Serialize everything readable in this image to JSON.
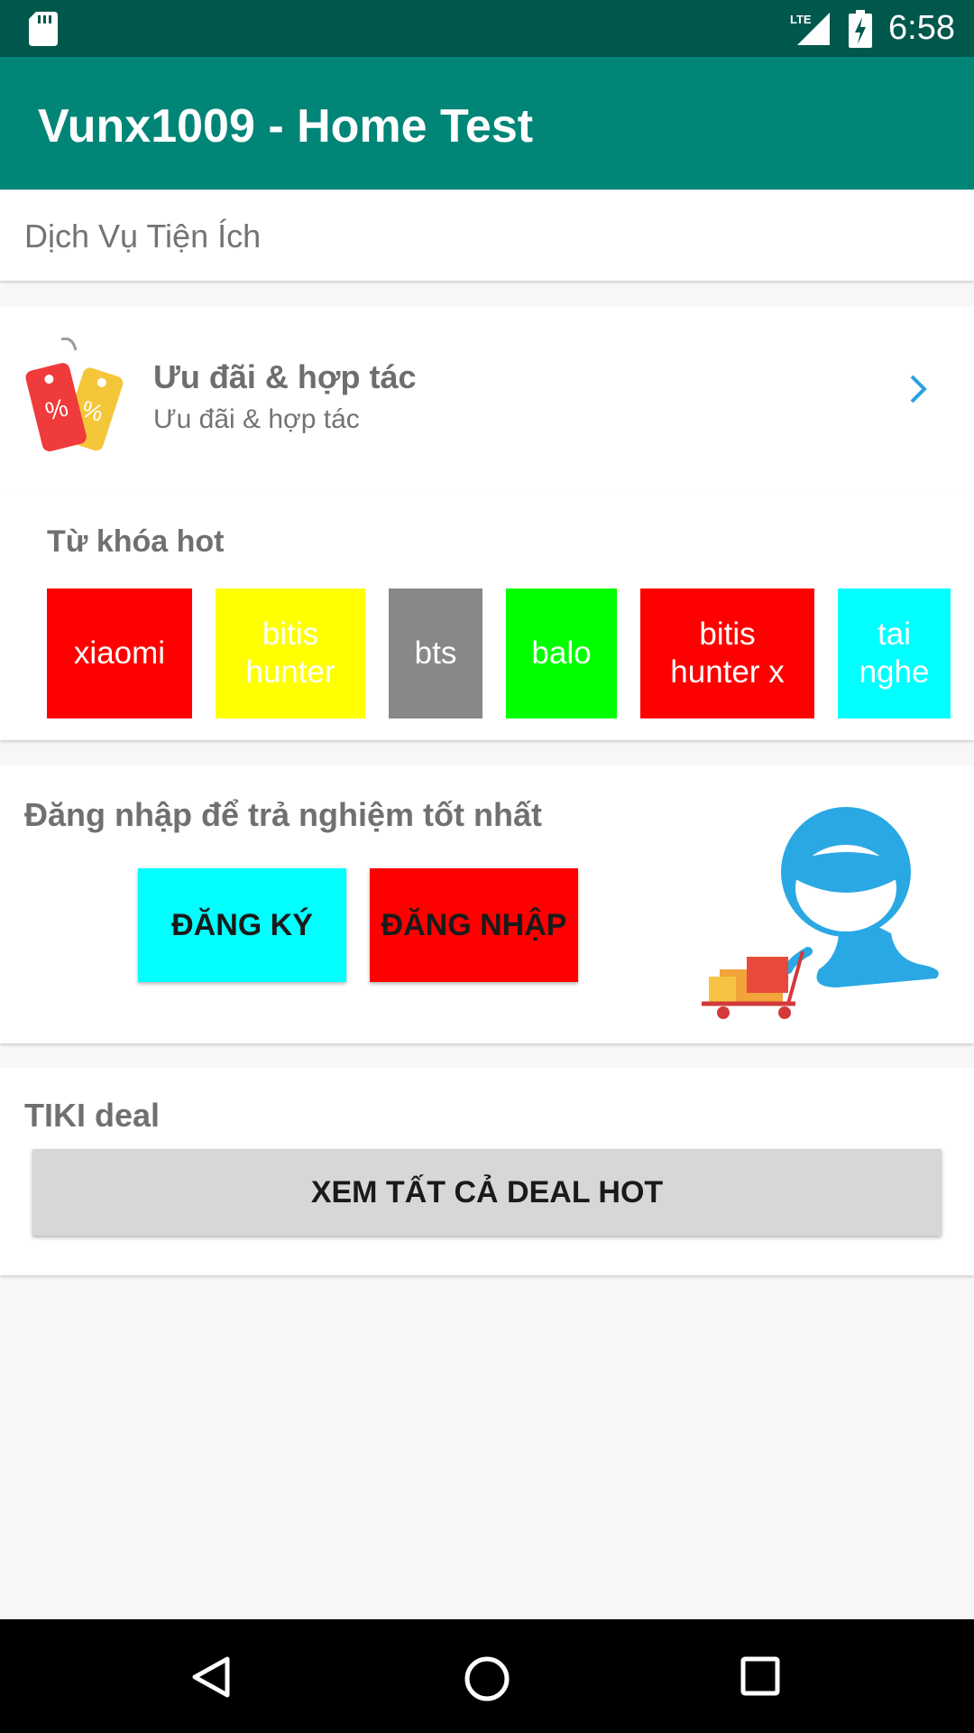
{
  "status_bar": {
    "time": "6:58",
    "network": "LTE",
    "icons": [
      "sd-card-icon",
      "lte-signal-icon",
      "battery-charging-icon"
    ]
  },
  "app_bar": {
    "title": "Vunx1009 - Home Test"
  },
  "services": {
    "header": "Dịch Vụ Tiện Ích"
  },
  "promo": {
    "title": "Ưu đãi & hợp tác",
    "subtitle": "Ưu đãi & hợp tác",
    "icon": "price-tag-icon",
    "chevron": "chevron-right-icon"
  },
  "hot_keywords": {
    "title": "Từ khóa hot",
    "items": [
      {
        "label": "xiaomi",
        "color": "#ff0000"
      },
      {
        "label": "bitis\nhunter",
        "color": "#ffff00"
      },
      {
        "label": "bts",
        "color": "#888888"
      },
      {
        "label": "balo",
        "color": "#00ff00"
      },
      {
        "label": "bitis\nhunter x",
        "color": "#ff0000"
      },
      {
        "label": "tai\nnghe",
        "color": "#00ffff"
      }
    ]
  },
  "login": {
    "title": "Đăng nhập để trả nghiệm tốt nhất",
    "register_label": "ĐĂNG KÝ",
    "register_color": "#00ffff",
    "login_label": "ĐĂNG NHẬP",
    "login_color": "#ff0000",
    "mascot": "tiki-mascot-illustration"
  },
  "deals": {
    "title": "TIKI deal",
    "button_label": "XEM TẤT CẢ DEAL HOT"
  },
  "nav_bar": {
    "icons": [
      "back-icon",
      "home-icon",
      "recents-icon"
    ]
  },
  "colors": {
    "primary": "#008577",
    "primary_dark": "#00574b",
    "accent_chevron": "#29a3e0"
  }
}
